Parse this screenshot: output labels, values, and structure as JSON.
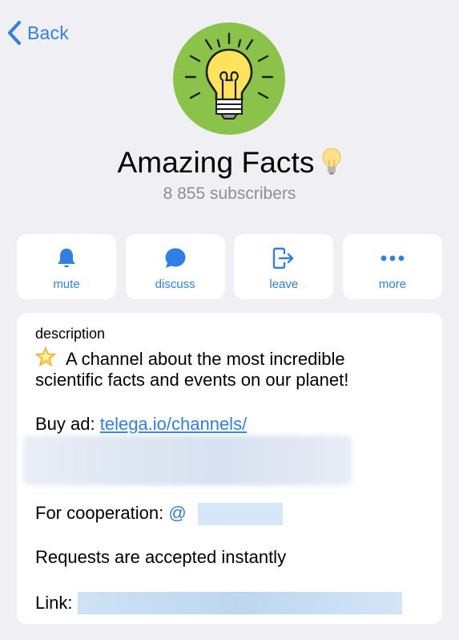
{
  "nav": {
    "back_label": "Back"
  },
  "channel": {
    "title": "Amazing Facts",
    "subscribers": "8 855 subscribers"
  },
  "actions": [
    {
      "label": "mute",
      "icon": "bell-icon"
    },
    {
      "label": "discuss",
      "icon": "chat-bubble-icon"
    },
    {
      "label": "leave",
      "icon": "leave-icon"
    },
    {
      "label": "more",
      "icon": "ellipsis-icon"
    }
  ],
  "description": {
    "label": "description",
    "line1": "A channel about the most incredible",
    "line2": "scientific facts and events on our planet!",
    "buy_ad_prefix": "Buy ad: ",
    "buy_ad_link": "telega.io/channels/",
    "cooperation_prefix": "For cooperation: ",
    "cooperation_mention": "@",
    "requests": "Requests are accepted instantly",
    "link_prefix": "Link: "
  },
  "colors": {
    "accent": "#2f7fe6",
    "background": "#efeff4",
    "avatar_bg": "#8bc34a",
    "secondary_text": "#8e8e93"
  }
}
